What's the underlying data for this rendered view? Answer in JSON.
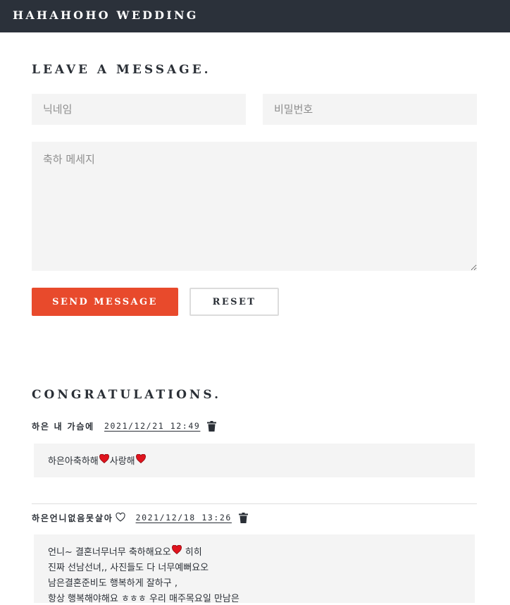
{
  "header": {
    "brand": "HAHAHOHO WEDDING"
  },
  "form": {
    "title": "LEAVE A MESSAGE.",
    "nickname_placeholder": "닉네임",
    "password_placeholder": "비밀번호",
    "message_placeholder": "축하 메세지",
    "send_label": "SEND MESSAGE",
    "reset_label": "RESET"
  },
  "guestbook": {
    "title": "CONGRATULATIONS.",
    "entries": [
      {
        "author": "하은 내 가슴에",
        "date": "2021/12/21 12:49",
        "lines": [
          [
            "하은아축하해",
            "heart-icon",
            "사랑해",
            "heart-icon"
          ]
        ]
      },
      {
        "author": "하은언니없음못살아",
        "author_icon": "white-heart-icon",
        "date": "2021/12/18 13:26",
        "lines": [
          [
            "언니~ 결혼너무너무 축하해요오",
            "heart-icon",
            " 히히"
          ],
          [
            "진짜 선남선녀,, 사진들도 다 너무예뻐요오"
          ],
          [
            "남은결혼준비도 행복하게 잘하구 ,"
          ],
          [
            "항상 행복해야해요 ㅎㅎㅎ 우리 매주목요일 만남은"
          ]
        ]
      }
    ]
  },
  "colors": {
    "header_bg": "#2b313a",
    "accent": "#e84a2c",
    "heart": "#e0141e",
    "field_bg": "#f4f4f4"
  }
}
